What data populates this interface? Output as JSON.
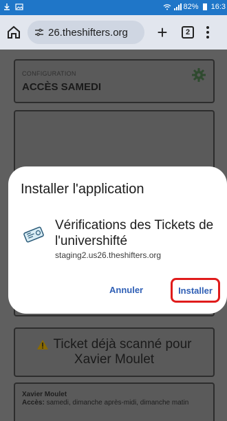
{
  "status_bar": {
    "battery": "82%",
    "time": "16:3"
  },
  "browser": {
    "url": "26.theshifters.org",
    "tab_count": "2"
  },
  "page": {
    "config_label": "CONFIGURATION",
    "config_title": "ACCÈS SAMEDI",
    "warning_line1": "Ticket déjà scanné pour",
    "warning_line2": "Xavier Moulet",
    "person_name": "Xavier Moulet",
    "access_label": "Accès:",
    "access_value": "samedi, dimanche après-midi, dimanche matin"
  },
  "dialog": {
    "title": "Installer l'application",
    "app_name": "Vérifications des Tickets de l'univershifté",
    "app_url": "staging2.us26.theshifters.org",
    "cancel_label": "Annuler",
    "install_label": "Installer"
  },
  "colors": {
    "status_bar": "#1f76c8",
    "toolbar": "#e2e6ee",
    "link_blue": "#2f5fb5",
    "highlight_red": "#e01b1b"
  }
}
